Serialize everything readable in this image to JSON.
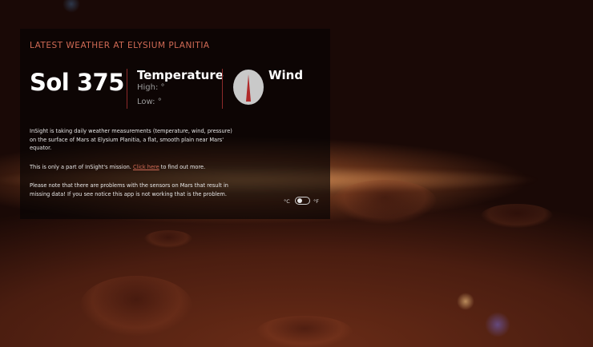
{
  "header": {
    "kicker": "LATEST WEATHER AT ELYSIUM PLANITIA",
    "sol": "Sol 375"
  },
  "temperature": {
    "title": "Temperature",
    "high": "High: °",
    "low": "Low: °"
  },
  "wind": {
    "title": "Wind",
    "compass_icon": "wind-direction-compass-icon"
  },
  "info": {
    "p1": "InSight is taking daily weather measurements (temperature, wind, pressure) on the surface of Mars at Elysium Planitia, a flat, smooth plain near Mars' equator.",
    "p2_before": "This is only a part of InSight's mission.",
    "p2_link": "Click here",
    "p2_after": "to find out more.",
    "p3": "Please note that there are problems with the sensors on Mars that result in missing data! If you see notice this app is not working that is the problem."
  },
  "units": {
    "celsius": "°C",
    "fahrenheit": "°F"
  },
  "colors": {
    "accent": "#d06a55",
    "divider": "#8d2a2a",
    "compass_needle": "#b02a2a"
  }
}
